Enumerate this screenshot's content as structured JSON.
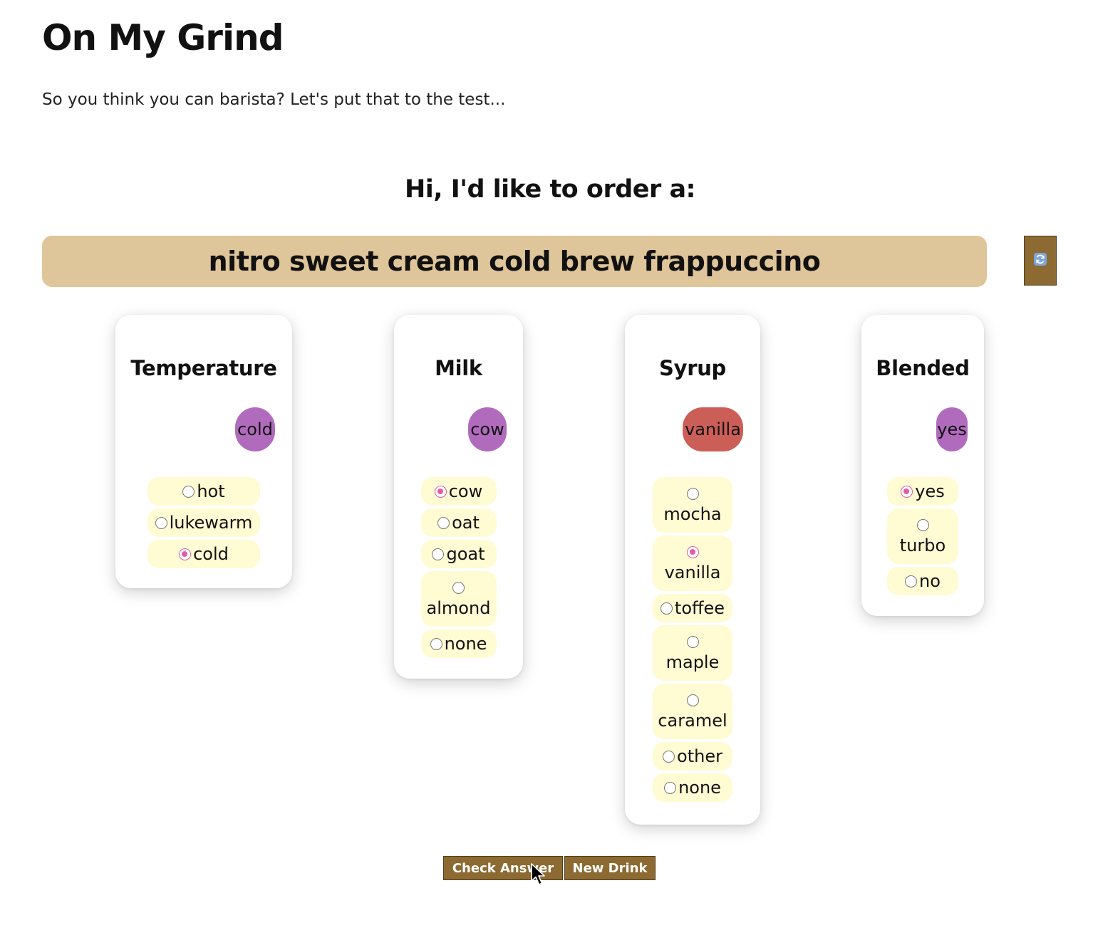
{
  "header": {
    "title": "On My Grind",
    "subtitle": "So you think you can barista? Let's put that to the test..."
  },
  "order": {
    "heading": "Hi, I'd like to order a:",
    "drink_name": "nitro sweet cream cold brew frappuccino",
    "refresh_icon": "refresh-icon"
  },
  "cards": {
    "temperature": {
      "title": "Temperature",
      "selected": "cold",
      "options": [
        "hot",
        "lukewarm",
        "cold"
      ]
    },
    "milk": {
      "title": "Milk",
      "selected": "cow",
      "options": [
        "cow",
        "oat",
        "goat",
        "almond",
        "none"
      ]
    },
    "syrup": {
      "title": "Syrup",
      "selected": "vanilla",
      "options": [
        "mocha",
        "vanilla",
        "toffee",
        "maple",
        "caramel",
        "other",
        "none"
      ]
    },
    "blended": {
      "title": "Blended",
      "selected": "yes",
      "options": [
        "yes",
        "turbo",
        "no"
      ]
    }
  },
  "colors": {
    "pill_correct": "#b16bbd",
    "pill_incorrect": "#cc5e58",
    "drink_bar": "#dfc59a",
    "button": "#8c6a32",
    "option_bg": "#fffbd2",
    "radio_checked": "#e35ba5"
  },
  "actions": {
    "check_label": "Check Answer",
    "new_label": "New Drink"
  }
}
